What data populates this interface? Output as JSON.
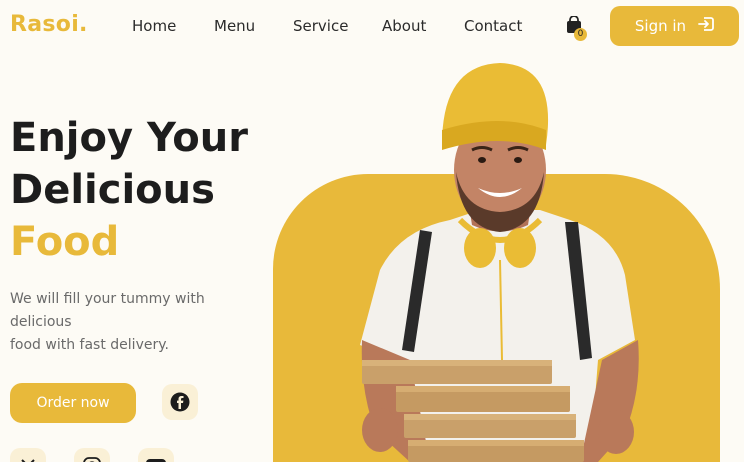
{
  "brand": {
    "logo": "Rasoi."
  },
  "nav": {
    "items": [
      {
        "label": "Home",
        "name": "nav-link-home"
      },
      {
        "label": "Menu",
        "name": "nav-link-menu"
      },
      {
        "label": "Service",
        "name": "nav-link-service"
      },
      {
        "label": "About",
        "name": "nav-link-about"
      },
      {
        "label": "Contact",
        "name": "nav-link-contact"
      }
    ],
    "cart_count": "0",
    "cart_icon": "shopping-bag-icon",
    "signin_label": "Sign in",
    "signin_icon": "sign-in-arrow-icon"
  },
  "hero": {
    "title_line1": "Enjoy Your",
    "title_line2": "Delicious",
    "title_accent": "Food",
    "subtitle_line1": "We will fill your tummy with",
    "subtitle_line2": "delicious",
    "subtitle_line3": "food with fast delivery.",
    "order_label": "Order now",
    "image_alt_icon": "delivery-man-with-pizza-boxes"
  },
  "social": [
    {
      "icon": "facebook-icon"
    },
    {
      "icon": "twitter-x-icon"
    },
    {
      "icon": "instagram-icon"
    },
    {
      "icon": "youtube-icon"
    }
  ],
  "colors": {
    "accent": "#e8b93a",
    "background": "#fdfbf5",
    "text": "#1d1d1d",
    "muted": "#6a6a6a"
  }
}
